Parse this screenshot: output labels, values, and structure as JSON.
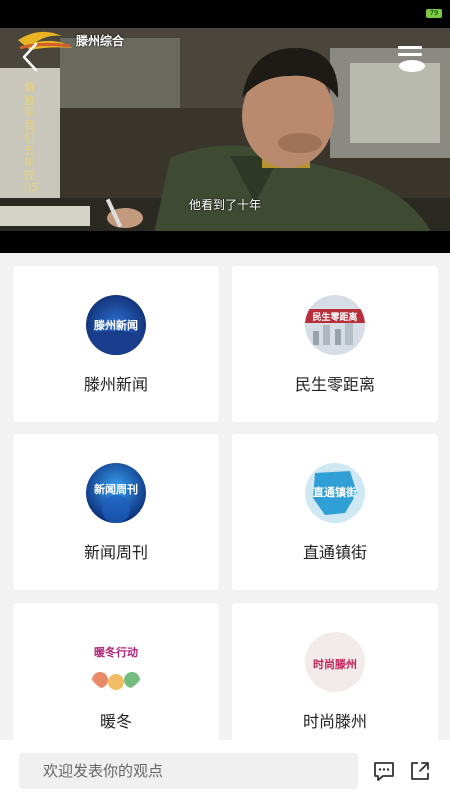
{
  "status_bar": {
    "battery_text": "79",
    "battery_color": "#7ac943"
  },
  "player": {
    "channel_name": "滕州综合",
    "vertical_text": "解放军我们五年轻05",
    "subtitle": "他看到了十年",
    "back_icon": "chevron-left-icon",
    "menu_icon": "playlist-menu-icon"
  },
  "programs": [
    {
      "label": "滕州新闻",
      "thumb_text": "滕州新闻",
      "thumb_colors": [
        "#0d2a6b",
        "#2f6fd1"
      ]
    },
    {
      "label": "民生零距离",
      "thumb_text": "民生零距离",
      "thumb_colors": [
        "#d7dde4",
        "#b00f1c"
      ]
    },
    {
      "label": "新闻周刊",
      "thumb_text": "新闻周刊",
      "thumb_colors": [
        "#0a2e7a",
        "#3aa0f0"
      ]
    },
    {
      "label": "直通镇街",
      "thumb_text": "直通镇街",
      "thumb_colors": [
        "#cfe8f3",
        "#2f9fd6"
      ]
    },
    {
      "label": "暖冬",
      "thumb_text": "暖冬行动",
      "thumb_colors": [
        "#ffffff",
        "#b0227a"
      ]
    },
    {
      "label": "时尚滕州",
      "thumb_text": "时尚滕州",
      "thumb_colors": [
        "#f3eaea",
        "#c2245a"
      ]
    }
  ],
  "comment_bar": {
    "placeholder": "欢迎发表你的观点",
    "chat_icon": "comment-icon",
    "share_icon": "share-icon"
  },
  "colors": {
    "page_bg": "#f2f2f2",
    "card_bg": "#ffffff",
    "text": "#222222"
  }
}
